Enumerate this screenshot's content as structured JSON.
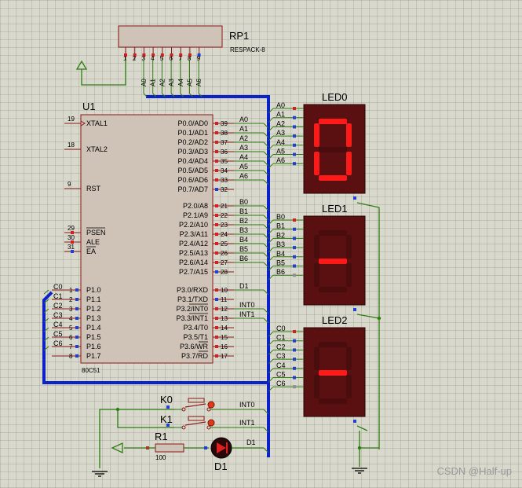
{
  "rp1": {
    "ref": "RP1",
    "value": "RESPACK-8",
    "pins": [
      "1",
      "2",
      "3",
      "4",
      "5",
      "6",
      "7",
      "8",
      "9"
    ],
    "bus_labels": [
      "A0",
      "A1",
      "A2",
      "A3",
      "A4",
      "A5",
      "A6"
    ]
  },
  "u1": {
    "ref": "U1",
    "value": "80C51",
    "left_pins": [
      {
        "num": "19",
        "name": "XTAL1"
      },
      {
        "num": "18",
        "name": "XTAL2"
      },
      {
        "num": "9",
        "name": "RST"
      },
      {
        "num": "29",
        "name": "PSEN"
      },
      {
        "num": "30",
        "name": "ALE"
      },
      {
        "num": "31",
        "name": "EA"
      }
    ],
    "port1_pins": [
      {
        "num": "1",
        "name": "P1.0",
        "net": "C0"
      },
      {
        "num": "2",
        "name": "P1.1",
        "net": "C1"
      },
      {
        "num": "3",
        "name": "P1.2",
        "net": "C2"
      },
      {
        "num": "4",
        "name": "P1.3",
        "net": "C3"
      },
      {
        "num": "5",
        "name": "P1.4",
        "net": "C4"
      },
      {
        "num": "6",
        "name": "P1.5",
        "net": "C5"
      },
      {
        "num": "7",
        "name": "P1.6",
        "net": "C6"
      },
      {
        "num": "8",
        "name": "P1.7",
        "net": ""
      }
    ],
    "port0_pins": [
      {
        "num": "39",
        "name": "P0.0/AD0",
        "net": "A0"
      },
      {
        "num": "38",
        "name": "P0.1/AD1",
        "net": "A1"
      },
      {
        "num": "37",
        "name": "P0.2/AD2",
        "net": "A2"
      },
      {
        "num": "36",
        "name": "P0.3/AD3",
        "net": "A3"
      },
      {
        "num": "35",
        "name": "P0.4/AD4",
        "net": "A4"
      },
      {
        "num": "34",
        "name": "P0.5/AD5",
        "net": "A5"
      },
      {
        "num": "33",
        "name": "P0.6/AD6",
        "net": "A6"
      },
      {
        "num": "32",
        "name": "P0.7/AD7",
        "net": ""
      }
    ],
    "port2_pins": [
      {
        "num": "21",
        "name": "P2.0/A8",
        "net": "B0"
      },
      {
        "num": "22",
        "name": "P2.1/A9",
        "net": "B1"
      },
      {
        "num": "23",
        "name": "P2.2/A10",
        "net": "B2"
      },
      {
        "num": "24",
        "name": "P2.3/A11",
        "net": "B3"
      },
      {
        "num": "25",
        "name": "P2.4/A12",
        "net": "B4"
      },
      {
        "num": "26",
        "name": "P2.5/A13",
        "net": "B5"
      },
      {
        "num": "27",
        "name": "P2.6/A14",
        "net": "B6"
      },
      {
        "num": "28",
        "name": "P2.7/A15",
        "net": ""
      }
    ],
    "port3_pins": [
      {
        "num": "10",
        "name": "P3.0/RXD",
        "net": "D1"
      },
      {
        "num": "11",
        "name": "P3.1/TXD",
        "net": ""
      },
      {
        "num": "12",
        "name": "P3.2/INT0",
        "net": "INT0"
      },
      {
        "num": "13",
        "name": "P3.3/INT1",
        "net": "INT1"
      },
      {
        "num": "14",
        "name": "P3.4/T0",
        "net": ""
      },
      {
        "num": "15",
        "name": "P3.5/T1",
        "net": ""
      },
      {
        "num": "16",
        "name": "P3.6/WR",
        "net": ""
      },
      {
        "num": "17",
        "name": "P3.7/RD",
        "net": ""
      }
    ]
  },
  "leds": [
    {
      "ref": "LED0",
      "nets": [
        "A0",
        "A1",
        "A2",
        "A3",
        "A4",
        "A5",
        "A6"
      ],
      "digit": "0"
    },
    {
      "ref": "LED1",
      "nets": [
        "B0",
        "B1",
        "B2",
        "B3",
        "B4",
        "B5",
        "B6"
      ],
      "digit": "-"
    },
    {
      "ref": "LED2",
      "nets": [
        "C0",
        "C1",
        "C2",
        "C3",
        "C4",
        "C5",
        "C6"
      ],
      "digit": "-"
    }
  ],
  "switches": [
    {
      "ref": "K0",
      "net": "INT0"
    },
    {
      "ref": "K1",
      "net": "INT1"
    }
  ],
  "r1": {
    "ref": "R1",
    "value": "100"
  },
  "d1": {
    "ref": "D1",
    "net": "D1"
  },
  "watermark": "CSDN @Half-up",
  "colors": {
    "bus": "#0b22c8",
    "wire": "#2e7d12",
    "component": "#8b1a1a",
    "chip_fill": "#cfc3b8",
    "led_on": "#ff1a1a",
    "led_off": "#4a0d0d"
  }
}
